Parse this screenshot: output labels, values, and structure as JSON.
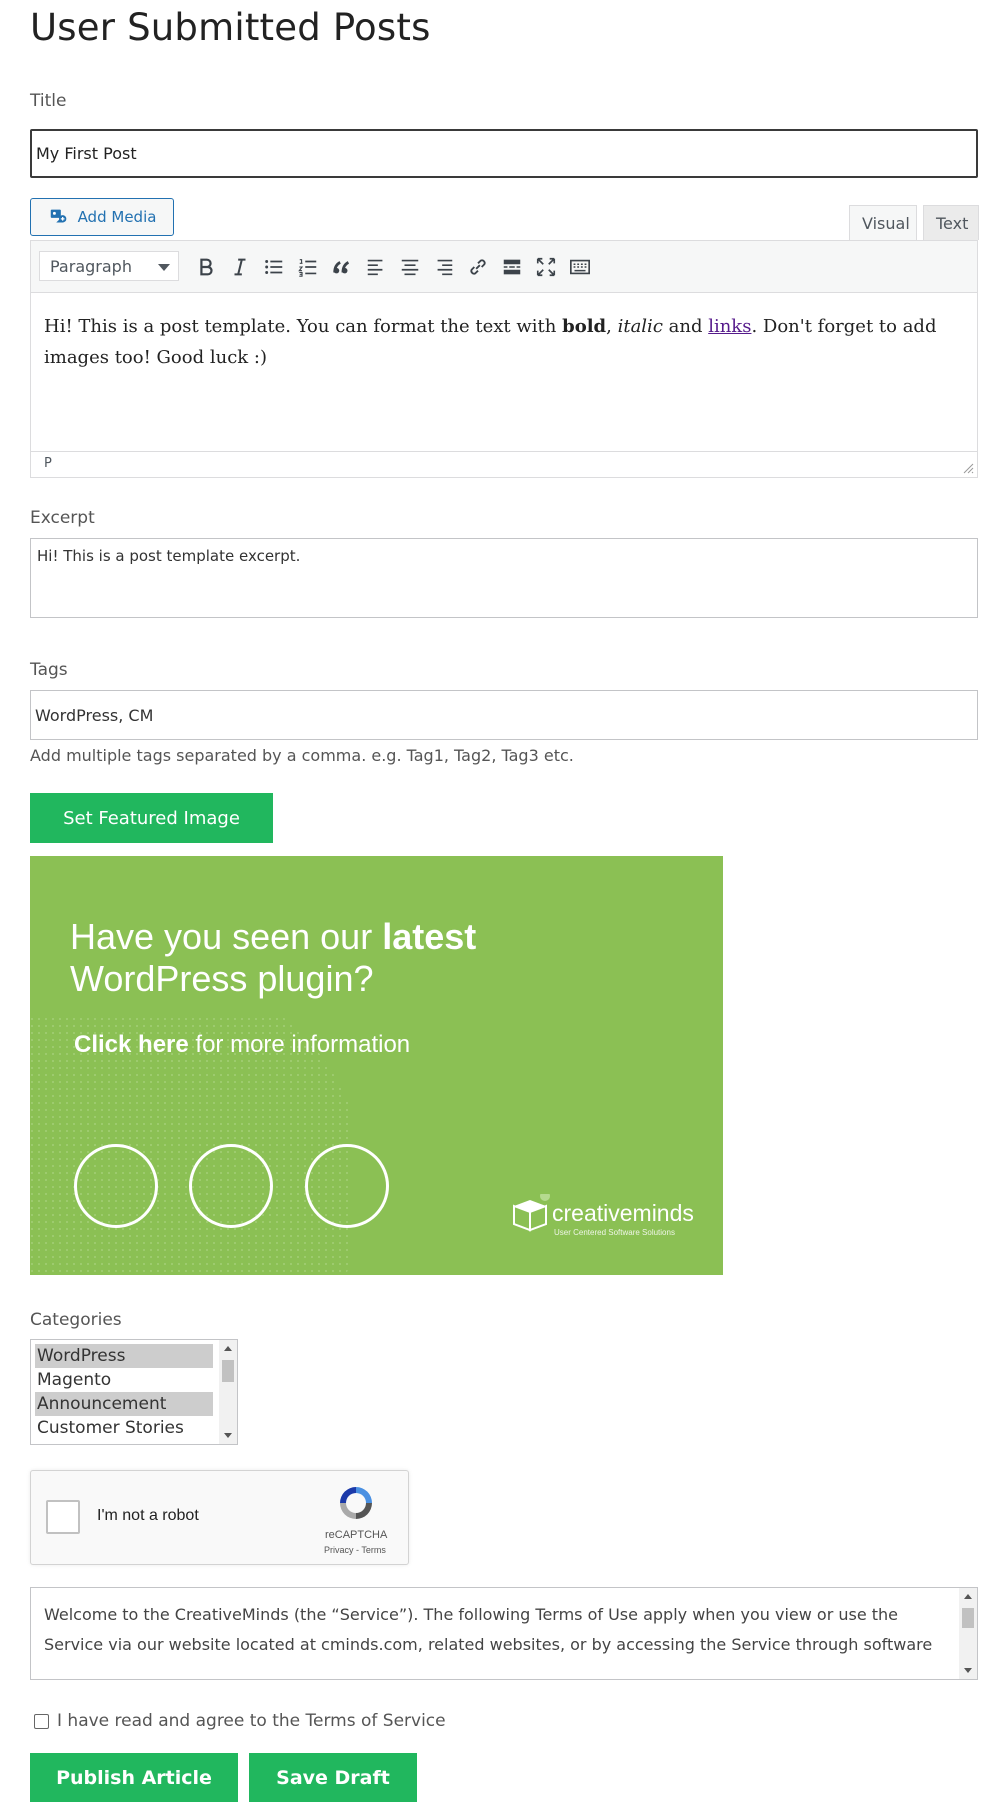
{
  "page": {
    "title": "User Submitted Posts"
  },
  "title_field": {
    "label": "Title",
    "value": "My First Post"
  },
  "editor": {
    "add_media_label": "Add Media",
    "tabs": {
      "visual": "Visual",
      "text": "Text"
    },
    "format_select": "Paragraph",
    "toolbar_icons": [
      "bold-icon",
      "italic-icon",
      "bulleted-list-icon",
      "numbered-list-icon",
      "blockquote-icon",
      "align-left-icon",
      "align-center-icon",
      "align-right-icon",
      "insert-link-icon",
      "read-more-icon",
      "fullscreen-icon",
      "toolbar-toggle-icon"
    ],
    "content": {
      "part1": "Hi! This is a post template. You can format the text with ",
      "bold": "bold",
      "part2": ", ",
      "italic": "italic",
      "part3": " and ",
      "link": "links",
      "part4": ". Don't forget to add images too! Good luck :)"
    },
    "path": "P"
  },
  "excerpt": {
    "label": "Excerpt",
    "value": "Hi! This is a post template excerpt."
  },
  "tags": {
    "label": "Tags",
    "value": "WordPress, CM",
    "help": "Add multiple tags separated by a comma. e.g. Tag1, Tag2, Tag3 etc."
  },
  "featured_image": {
    "button_label": "Set Featured Image",
    "banner": {
      "line1_prefix": "Have you seen our ",
      "line1_bold": "latest",
      "line2": "WordPress plugin?",
      "cta_bold": "Click here",
      "cta_rest": " for more information",
      "logo_text": "creativeminds",
      "logo_sub": "User Centered Software Solutions",
      "bg_color": "#8bc054"
    }
  },
  "categories": {
    "label": "Categories",
    "items": [
      {
        "label": "WordPress",
        "selected": true
      },
      {
        "label": "Magento",
        "selected": false
      },
      {
        "label": "Announcement",
        "selected": true
      },
      {
        "label": "Customer Stories",
        "selected": false
      }
    ]
  },
  "recaptcha": {
    "label": "I'm not a robot",
    "brand": "reCAPTCHA",
    "privacy": "Privacy",
    "separator": " - ",
    "terms": "Terms"
  },
  "terms": {
    "text": "Welcome to the CreativeMinds (the “Service”). The following Terms of Use apply when you view or use the Service via our website located at cminds.com, related websites, or by accessing the Service through software",
    "agree_label": "I have read and agree to the Terms of Service"
  },
  "actions": {
    "publish": "Publish Article",
    "save_draft": "Save Draft"
  },
  "colors": {
    "accent_green": "#21b75e",
    "link_blue": "#2271b1"
  }
}
